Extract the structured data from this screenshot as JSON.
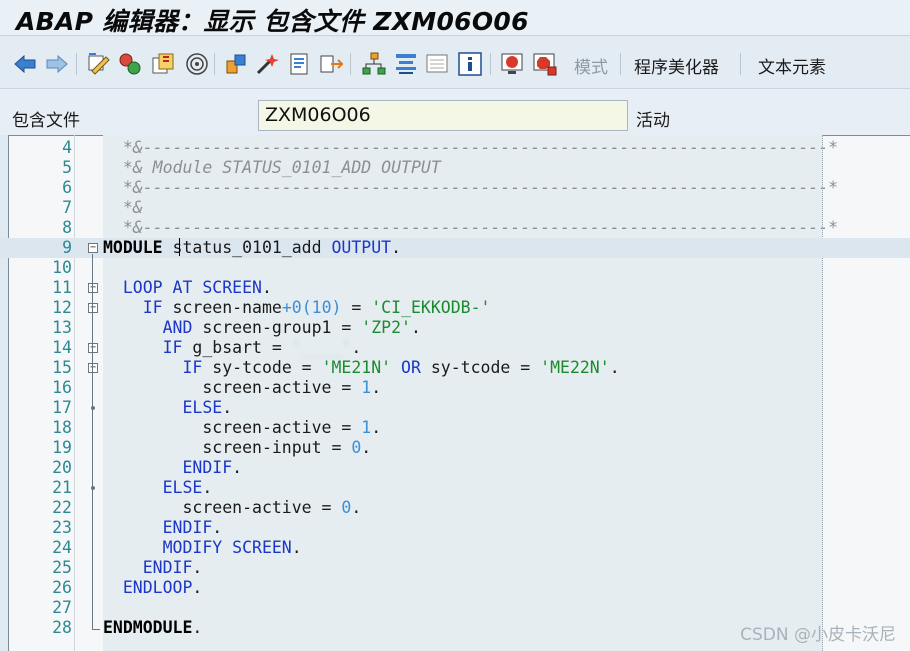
{
  "window": {
    "title": "ABAP 编辑器：显示 包含文件 ZXM06O06"
  },
  "toolbar": {
    "icons": [
      "back-icon",
      "forward-icon",
      "display-change-icon",
      "active-inactive-icon",
      "other-object-icon",
      "where-used-icon",
      "check-icon",
      "activate-icon",
      "test-icon",
      "navigate-icon",
      "object-list-icon",
      "hierarchy-icon",
      "enhance-icon",
      "help-icon",
      "breakpoint-icon",
      "stop-icon"
    ],
    "mode_label": "模式",
    "pretty_printer_label": "程序美化器",
    "text_elements_label": "文本元素"
  },
  "include_field": {
    "label": "包含文件",
    "value": "ZXM06O06",
    "status": "活动"
  },
  "watermark": "CSDN @小皮卡沃尼",
  "code": {
    "lines": [
      {
        "num": "4",
        "parts": [
          {
            "t": "  *&---------------------------------------------------------------------*",
            "c": "cmt"
          }
        ]
      },
      {
        "num": "5",
        "parts": [
          {
            "t": "  *& Module STATUS_0101_ADD OUTPUT",
            "c": "cmt"
          }
        ]
      },
      {
        "num": "6",
        "parts": [
          {
            "t": "  *&---------------------------------------------------------------------*",
            "c": "cmt"
          }
        ]
      },
      {
        "num": "7",
        "parts": [
          {
            "t": "  *&",
            "c": "cmt"
          }
        ]
      },
      {
        "num": "8",
        "parts": [
          {
            "t": "  *&---------------------------------------------------------------------*",
            "c": "cmt"
          }
        ]
      },
      {
        "num": "9",
        "parts": [
          {
            "t": "MODULE",
            "c": "kwb"
          },
          {
            "t": " status_0101_add ",
            "c": "id"
          },
          {
            "t": "OUTPUT",
            "c": "kw"
          },
          {
            "t": ".",
            "c": "id"
          }
        ]
      },
      {
        "num": "10",
        "parts": []
      },
      {
        "num": "11",
        "parts": [
          {
            "t": "  LOOP AT SCREEN",
            "c": "kw"
          },
          {
            "t": ".",
            "c": "id"
          }
        ]
      },
      {
        "num": "12",
        "parts": [
          {
            "t": "    IF",
            "c": "kw"
          },
          {
            "t": " screen-name",
            "c": "id"
          },
          {
            "t": "+0(10)",
            "c": "num"
          },
          {
            "t": " = ",
            "c": "id"
          },
          {
            "t": "'CI_EKKODB-'",
            "c": "str"
          }
        ]
      },
      {
        "num": "13",
        "parts": [
          {
            "t": "      AND",
            "c": "kw"
          },
          {
            "t": " screen-group1 = ",
            "c": "id"
          },
          {
            "t": "'ZP2'",
            "c": "str"
          },
          {
            "t": ".",
            "c": "id"
          }
        ]
      },
      {
        "num": "14",
        "parts": [
          {
            "t": "      IF",
            "c": "kw"
          },
          {
            "t": " g_bsart = ",
            "c": "id"
          },
          {
            "t": "'____'",
            "c": "blur"
          },
          {
            "t": ".",
            "c": "id"
          }
        ]
      },
      {
        "num": "15",
        "parts": [
          {
            "t": "        IF",
            "c": "kw"
          },
          {
            "t": " sy-tcode = ",
            "c": "id"
          },
          {
            "t": "'ME21N'",
            "c": "str"
          },
          {
            "t": " OR",
            "c": "kw"
          },
          {
            "t": " sy-tcode = ",
            "c": "id"
          },
          {
            "t": "'ME22N'",
            "c": "str"
          },
          {
            "t": ".",
            "c": "id"
          }
        ]
      },
      {
        "num": "16",
        "parts": [
          {
            "t": "          screen-active = ",
            "c": "id"
          },
          {
            "t": "1",
            "c": "num"
          },
          {
            "t": ".",
            "c": "id"
          }
        ]
      },
      {
        "num": "17",
        "parts": [
          {
            "t": "        ELSE",
            "c": "kw"
          },
          {
            "t": ".",
            "c": "id"
          }
        ]
      },
      {
        "num": "18",
        "parts": [
          {
            "t": "          screen-active = ",
            "c": "id"
          },
          {
            "t": "1",
            "c": "num"
          },
          {
            "t": ".",
            "c": "id"
          }
        ]
      },
      {
        "num": "19",
        "parts": [
          {
            "t": "          screen-input = ",
            "c": "id"
          },
          {
            "t": "0",
            "c": "num"
          },
          {
            "t": ".",
            "c": "id"
          }
        ]
      },
      {
        "num": "20",
        "parts": [
          {
            "t": "        ENDIF",
            "c": "kw"
          },
          {
            "t": ".",
            "c": "id"
          }
        ]
      },
      {
        "num": "21",
        "parts": [
          {
            "t": "      ELSE",
            "c": "kw"
          },
          {
            "t": ".",
            "c": "id"
          }
        ]
      },
      {
        "num": "22",
        "parts": [
          {
            "t": "        screen-active = ",
            "c": "id"
          },
          {
            "t": "0",
            "c": "num"
          },
          {
            "t": ".",
            "c": "id"
          }
        ]
      },
      {
        "num": "23",
        "parts": [
          {
            "t": "      ENDIF",
            "c": "kw"
          },
          {
            "t": ".",
            "c": "id"
          }
        ]
      },
      {
        "num": "24",
        "parts": [
          {
            "t": "      MODIFY SCREEN",
            "c": "kw"
          },
          {
            "t": ".",
            "c": "id"
          }
        ]
      },
      {
        "num": "25",
        "parts": [
          {
            "t": "    ENDIF",
            "c": "kw"
          },
          {
            "t": ".",
            "c": "id"
          }
        ]
      },
      {
        "num": "26",
        "parts": [
          {
            "t": "  ENDLOOP",
            "c": "kw"
          },
          {
            "t": ".",
            "c": "id"
          }
        ]
      },
      {
        "num": "27",
        "parts": []
      },
      {
        "num": "28",
        "parts": [
          {
            "t": "ENDMODULE",
            "c": "kwb"
          },
          {
            "t": ".",
            "c": "id"
          }
        ]
      }
    ]
  }
}
